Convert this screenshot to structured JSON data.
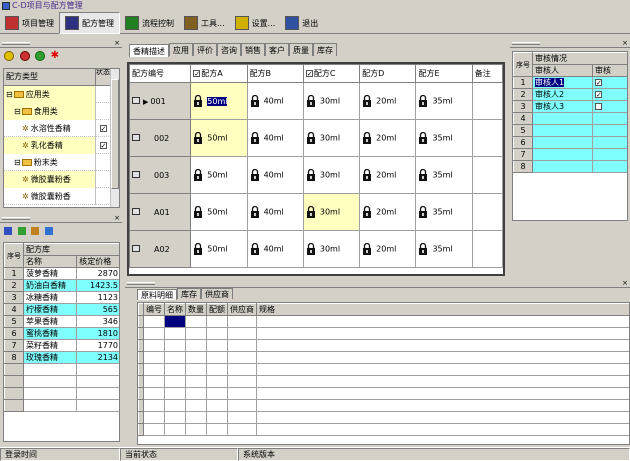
{
  "app": {
    "title": "C-D项目与配方管理"
  },
  "toolbar": [
    {
      "label": "项目管理",
      "icon": "bar-chart-icon",
      "color": "#c03030"
    },
    {
      "label": "配方管理",
      "icon": "recipe-icon",
      "color": "#303080"
    },
    {
      "label": "流程控制",
      "icon": "flow-icon",
      "color": "#208020"
    },
    {
      "label": "工具...",
      "icon": "tools-icon",
      "color": "#806020"
    },
    {
      "label": "设置...",
      "icon": "bulb-icon",
      "color": "#d0b000"
    },
    {
      "label": "退出",
      "icon": "exit-icon",
      "color": "#3050a0"
    }
  ],
  "tree": {
    "header": {
      "type": "配方类型",
      "state": "状态"
    },
    "items": [
      {
        "label": "应用类",
        "level": 0,
        "kind": "folder",
        "checked": false,
        "hl": true
      },
      {
        "label": "食用类",
        "level": 1,
        "kind": "folder",
        "checked": false,
        "hl": true
      },
      {
        "label": "水溶性香精",
        "level": 2,
        "kind": "leaf",
        "checked": true,
        "hl": false
      },
      {
        "label": "乳化香精",
        "level": 2,
        "kind": "leaf",
        "checked": true,
        "hl": true
      },
      {
        "label": "粉末类",
        "level": 1,
        "kind": "folder",
        "checked": false,
        "hl": false
      },
      {
        "label": "微胶囊粉香",
        "level": 2,
        "kind": "leaf",
        "checked": false,
        "hl": true
      },
      {
        "label": "微胶囊粉香",
        "level": 2,
        "kind": "leaf",
        "checked": false,
        "hl": false
      }
    ]
  },
  "library": {
    "caption": "配方库",
    "columns": [
      "名称",
      "核定价格"
    ],
    "rows": [
      {
        "no": "1",
        "name": "菠萝香精",
        "price": "2870",
        "cyan": false
      },
      {
        "no": "2",
        "name": "奶油白香精",
        "price": "1423.5",
        "cyan": true
      },
      {
        "no": "3",
        "name": "冰糖香精",
        "price": "1123",
        "cyan": false
      },
      {
        "no": "4",
        "name": "柠檬香精",
        "price": "565",
        "cyan": true
      },
      {
        "no": "5",
        "name": "苹果香精",
        "price": "346",
        "cyan": false
      },
      {
        "no": "6",
        "name": "蜜桃香精",
        "price": "1810",
        "cyan": true
      },
      {
        "no": "7",
        "name": "菜籽香精",
        "price": "1770",
        "cyan": false
      },
      {
        "no": "8",
        "name": "玫瑰香精",
        "price": "2134",
        "cyan": true
      }
    ]
  },
  "main_tabs": [
    "香精描述",
    "应用",
    "评价",
    "咨询",
    "销售",
    "客户",
    "质量",
    "库存"
  ],
  "formula": {
    "columns": [
      "配方编号",
      "配方A",
      "配方B",
      "配方C",
      "配方D",
      "配方E",
      "备注"
    ],
    "checked_cols": [
      1,
      3
    ],
    "rows": [
      {
        "id": "001",
        "vals": [
          "50ml",
          "40ml",
          "30ml",
          "20ml",
          "35ml"
        ],
        "sel": true
      },
      {
        "id": "002",
        "vals": [
          "50ml",
          "40ml",
          "30ml",
          "20ml",
          "35ml"
        ],
        "sel": false
      },
      {
        "id": "003",
        "vals": [
          "50ml",
          "40ml",
          "30ml",
          "20ml",
          "35ml"
        ],
        "sel": false
      },
      {
        "id": "A01",
        "vals": [
          "50ml",
          "40ml",
          "30ml",
          "20ml",
          "35ml"
        ],
        "sel": false
      },
      {
        "id": "A02",
        "vals": [
          "50ml",
          "40ml",
          "30ml",
          "20ml",
          "35ml"
        ],
        "sel": false
      }
    ]
  },
  "approval": {
    "title": "审核情况",
    "columns": [
      "审核人",
      "审核"
    ],
    "rows": [
      {
        "no": "1",
        "name": "审核人1",
        "checked": true
      },
      {
        "no": "2",
        "name": "审核人2",
        "checked": true
      },
      {
        "no": "3",
        "name": "审核人3",
        "checked": false
      },
      {
        "no": "4",
        "name": "",
        "checked": null
      },
      {
        "no": "5",
        "name": "",
        "checked": null
      },
      {
        "no": "6",
        "name": "",
        "checked": null
      },
      {
        "no": "7",
        "name": "",
        "checked": null
      },
      {
        "no": "8",
        "name": "",
        "checked": null
      }
    ]
  },
  "bottom_tabs": [
    "原料明细",
    "库存",
    "供应商"
  ],
  "materials": {
    "columns": [
      "编号",
      "名称",
      "数量",
      "配额",
      "供应商",
      "规格"
    ]
  },
  "status": {
    "login": "登录时间",
    "current": "当前状态",
    "version": "系统版本"
  }
}
